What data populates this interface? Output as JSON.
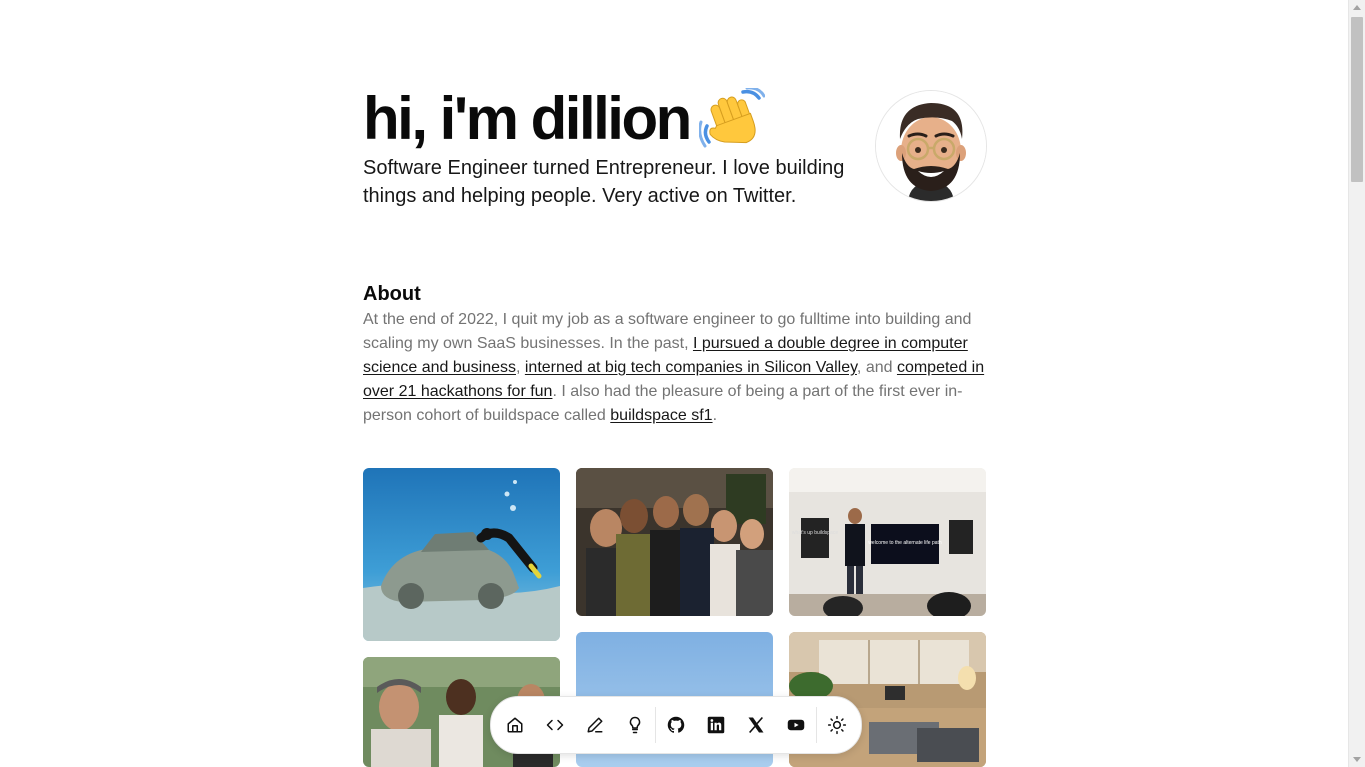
{
  "hero": {
    "title": "hi, i'm dillion",
    "subtitle": "Software Engineer turned Entrepreneur. I love building things and helping people. Very active on Twitter."
  },
  "about": {
    "heading": "About",
    "text_1": "At the end of 2022, I quit my job as a software engineer to go fulltime into building and scaling my own SaaS businesses. In the past, ",
    "link_1": "I pursued a double degree in computer science and business",
    "sep_1": ", ",
    "link_2": "interned at big tech companies in Silicon Valley",
    "sep_2": ", and ",
    "link_3": "competed in over 21 hackathons for fun",
    "text_2": ". I also had the pleasure of being a part of the first ever in-person cohort of buildspace called ",
    "link_4": "buildspace sf1",
    "text_3": "."
  },
  "photos": {
    "screen_text": "welcome to the alternate life path",
    "board_text": "what's up buildspace"
  },
  "dock": {
    "items": [
      {
        "icon": "home-icon"
      },
      {
        "icon": "code-icon"
      },
      {
        "icon": "pencil-icon"
      },
      {
        "icon": "lightbulb-icon"
      },
      {
        "icon": "github-icon"
      },
      {
        "icon": "linkedin-icon"
      },
      {
        "icon": "x-icon"
      },
      {
        "icon": "youtube-icon"
      },
      {
        "icon": "sun-icon"
      }
    ]
  },
  "colors": {
    "text": "#0a0a0a",
    "muted": "#737373",
    "border": "#e5e5e5"
  }
}
